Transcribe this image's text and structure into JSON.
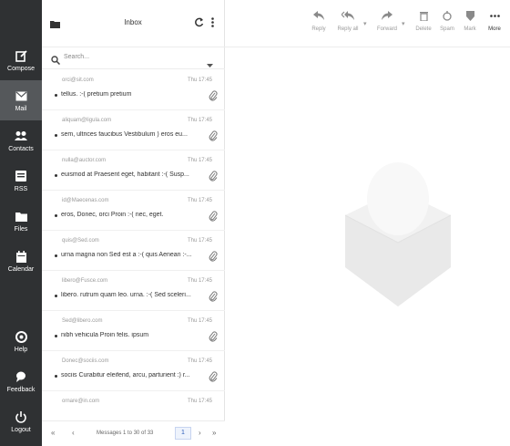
{
  "rail": [
    {
      "label": "Compose",
      "icon": "compose-icon"
    },
    {
      "label": "Mail",
      "icon": "mail-icon",
      "active": true
    },
    {
      "label": "Contacts",
      "icon": "contacts-icon"
    },
    {
      "label": "RSS",
      "icon": "rss-icon"
    },
    {
      "label": "Files",
      "icon": "folder-icon"
    },
    {
      "label": "Calendar",
      "icon": "calendar-icon"
    },
    {
      "label": "Help",
      "icon": "help-icon"
    },
    {
      "label": "Feedback",
      "icon": "feedback-icon"
    },
    {
      "label": "Logout",
      "icon": "power-icon"
    }
  ],
  "list": {
    "title": "Inbox",
    "search_placeholder": "Search...",
    "messages": [
      {
        "from": "orci@sit.com",
        "date": "Thu 17:45",
        "subject": "tellus. :-( pretium pretium",
        "attachment": true
      },
      {
        "from": "aliquam@ligula.com",
        "date": "Thu 17:45",
        "subject": "sem, ultrices faucibus Vestibulum ) eros eu...",
        "attachment": true
      },
      {
        "from": "nulla@auctor.com",
        "date": "Thu 17:45",
        "subject": "euismod at Praesent eget, habitant :-( Susp...",
        "attachment": true
      },
      {
        "from": "id@Maecenas.com",
        "date": "Thu 17:45",
        "subject": "eros, Donec, orci Proin :-( nec, eget.",
        "attachment": true
      },
      {
        "from": "quis@Sed.com",
        "date": "Thu 17:45",
        "subject": "urna magna non Sed est a :-( quis Aenean :-...",
        "attachment": true
      },
      {
        "from": "libero@Fusce.com",
        "date": "Thu 17:45",
        "subject": "libero. rutrum quam leo. urna. :-( Sed sceleri...",
        "attachment": true
      },
      {
        "from": "Sed@libero.com",
        "date": "Thu 17:45",
        "subject": "nibh vehicula Proin felis. ipsum",
        "attachment": true
      },
      {
        "from": "Donec@sociis.com",
        "date": "Thu 17:45",
        "subject": "sociis Curabitur eleifend, arcu, parturient :) r...",
        "attachment": true
      },
      {
        "from": "ornare@in.com",
        "date": "Thu 17:45",
        "subject": "",
        "attachment": false
      }
    ]
  },
  "pager": {
    "first": "«",
    "prev": "‹",
    "info": "Messages 1 to 30 of 33",
    "page": "1",
    "next": "›",
    "last": "»"
  },
  "toolbar": [
    {
      "label": "Reply",
      "icon": "reply-icon"
    },
    {
      "label": "Reply all",
      "icon": "reply-all-icon"
    },
    {
      "label": "Forward",
      "icon": "forward-icon"
    },
    {
      "label": "Delete",
      "icon": "trash-icon"
    },
    {
      "label": "Spam",
      "icon": "spam-icon"
    },
    {
      "label": "Mark",
      "icon": "mark-icon"
    },
    {
      "label": "More",
      "icon": "more-icon"
    }
  ]
}
